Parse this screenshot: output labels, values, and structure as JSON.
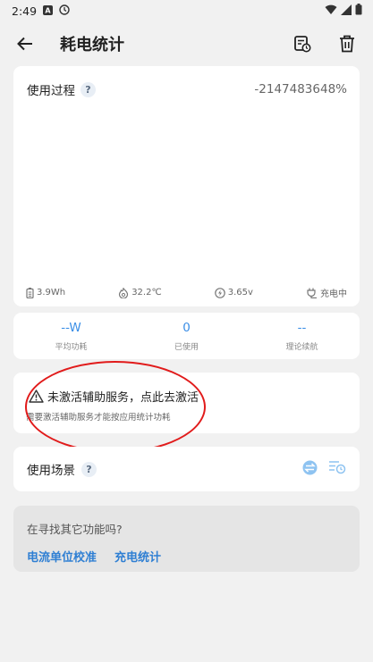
{
  "status_bar": {
    "time": "2:49"
  },
  "app_bar": {
    "title": "耗电统计"
  },
  "usage": {
    "title": "使用过程",
    "help": "?",
    "percent": "-2147483648%",
    "stats": {
      "capacity": "3.9Wh",
      "temperature": "32.2℃",
      "voltage": "3.65v",
      "charge_state": "充电中"
    }
  },
  "metrics": [
    {
      "value": "--W",
      "label": "平均功耗"
    },
    {
      "value": "0",
      "label": "已使用"
    },
    {
      "value": "--",
      "label": "理论续航"
    }
  ],
  "warning": {
    "title": "未激活辅助服务，点此去激活",
    "description": "需要激活辅助服务才能按应用统计功耗"
  },
  "scene": {
    "title": "使用场景",
    "help": "?"
  },
  "find": {
    "title": "在寻找其它功能吗?",
    "links": [
      "电流单位校准",
      "充电统计"
    ]
  },
  "colors": {
    "accent": "#3a8ee6",
    "annotation": "#e11b1b",
    "background": "#f1f1f1"
  }
}
